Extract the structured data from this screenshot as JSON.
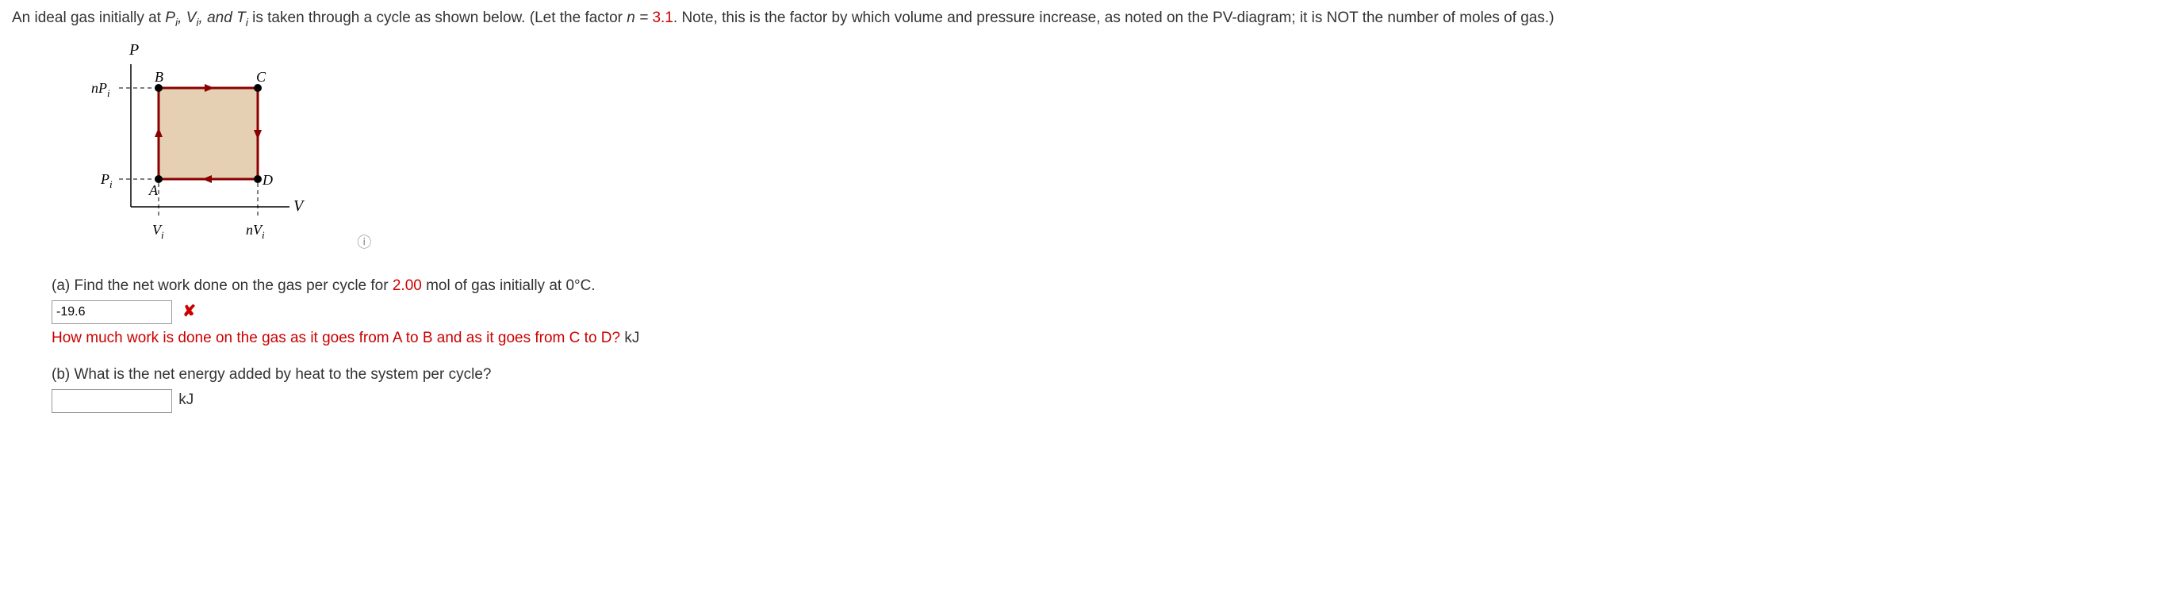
{
  "problem": {
    "prefix": "An ideal gas initially at ",
    "vars": "P_i, V_i, and T_i",
    "mid1": " is taken through a cycle as shown below. (Let the factor ",
    "n_eq": "n = ",
    "n_val": "3.1",
    "suffix": ". Note, this is the factor by which volume and pressure increase, as noted on the PV-diagram; it is NOT the number of moles of gas.)"
  },
  "diagram": {
    "y_axis": "P",
    "x_axis": "V",
    "y_tick_top": "nP",
    "y_tick_top_sub": "i",
    "y_tick_bottom": "P",
    "y_tick_bottom_sub": "i",
    "x_tick_left": "V",
    "x_tick_left_sub": "i",
    "x_tick_right": "nV",
    "x_tick_right_sub": "i",
    "pt_A": "A",
    "pt_B": "B",
    "pt_C": "C",
    "pt_D": "D"
  },
  "part_a": {
    "label": "(a) Find the net work done on the gas per cycle for ",
    "mol": "2.00",
    "label2": " mol of gas initially at 0°C.",
    "input_value": "-19.6",
    "hint": "How much work is done on the gas as it goes from A to B and as it goes from C to D?",
    "unit": "kJ"
  },
  "part_b": {
    "label": "(b) What is the net energy added by heat to the system per cycle?",
    "input_value": "",
    "unit": "kJ"
  },
  "chart_data": {
    "type": "line",
    "title": "PV-diagram cycle",
    "xlabel": "V",
    "ylabel": "P",
    "x_ticks": [
      "V_i",
      "nV_i"
    ],
    "y_ticks": [
      "P_i",
      "nP_i"
    ],
    "n": 3.1,
    "points": [
      {
        "name": "A",
        "V": "V_i",
        "P": "P_i"
      },
      {
        "name": "B",
        "V": "V_i",
        "P": "nP_i"
      },
      {
        "name": "C",
        "V": "nV_i",
        "P": "nP_i"
      },
      {
        "name": "D",
        "V": "nV_i",
        "P": "P_i"
      }
    ],
    "cycle_direction": "clockwise A→B→C→D→A"
  }
}
